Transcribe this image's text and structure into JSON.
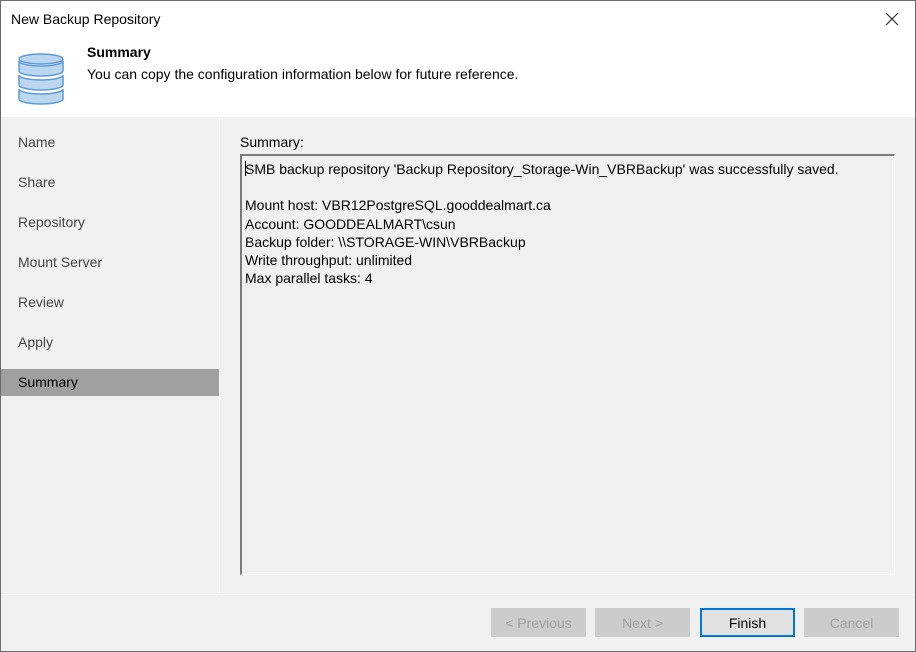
{
  "window": {
    "title": "New Backup Repository",
    "close_icon": "close-icon"
  },
  "header": {
    "icon": "database-icon",
    "title": "Summary",
    "subtitle": "You can copy the configuration information below for future reference."
  },
  "sidebar": {
    "steps": [
      {
        "label": "Name",
        "active": false
      },
      {
        "label": "Share",
        "active": false
      },
      {
        "label": "Repository",
        "active": false
      },
      {
        "label": "Mount Server",
        "active": false
      },
      {
        "label": "Review",
        "active": false
      },
      {
        "label": "Apply",
        "active": false
      },
      {
        "label": "Summary",
        "active": true
      }
    ]
  },
  "main": {
    "summary_label": "Summary:",
    "summary_lines": [
      "SMB backup repository 'Backup Repository_Storage-Win_VBRBackup' was successfully saved.",
      "",
      "Mount host: VBR12PostgreSQL.gooddealmart.ca",
      "Account: GOODDEALMART\\csun",
      "Backup folder: \\\\STORAGE-WIN\\VBRBackup",
      "Write throughput: unlimited",
      "Max parallel tasks: 4"
    ]
  },
  "footer": {
    "previous_label": "< Previous",
    "next_label": "Next >",
    "finish_label": "Finish",
    "cancel_label": "Cancel"
  },
  "colors": {
    "focus_border": "#0078d7",
    "active_step_bg": "#a0a0a0",
    "icon_fill": "#bcd6f0",
    "icon_stroke": "#5b9bd5"
  }
}
